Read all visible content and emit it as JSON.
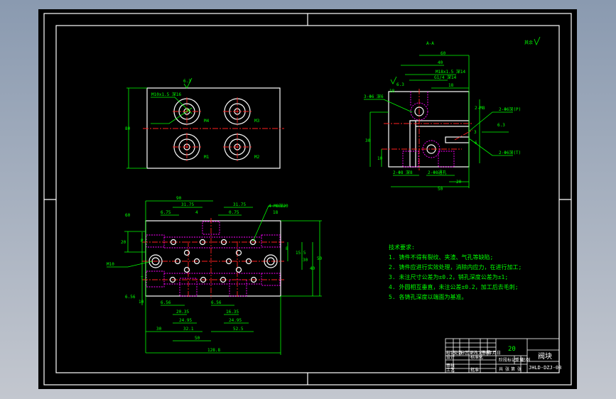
{
  "drawing": {
    "section_label": "A-A",
    "roughness_note": "其余",
    "roughness_value": "6.3",
    "top_view": {
      "dims": [
        "80",
        "6.3",
        "M10x1.5 深16",
        "M4",
        "M3",
        "M1",
        "M2"
      ]
    },
    "section_view": {
      "dims": [
        "60",
        "40",
        "M18x1.5 深14",
        "G1/4 深14",
        "18",
        "30",
        "6.3",
        "3-Φ6 深6",
        "2-Φ8 深8",
        "2-Φ8通孔",
        "2-M8",
        "10",
        "50",
        "20",
        "18",
        "6.3",
        "2-Φ6深(P)",
        "2-Φ6深(T)",
        "3",
        "6"
      ]
    },
    "front_view": {
      "dims": [
        "90",
        "31.75",
        "31.75",
        "6.75",
        "4",
        "0.75",
        "18",
        "4-M8深20",
        "20",
        "P",
        "T",
        "8",
        "15.5",
        "30",
        "40",
        "50",
        "60",
        "6.56",
        "6.56",
        "20.35",
        "16.35",
        "24.95",
        "24.95",
        "30",
        "32.1",
        "52.5",
        "50",
        "128.8",
        "M10",
        "10"
      ]
    },
    "tech_requirements": {
      "title": "技术要求:",
      "items": [
        "1. 铸件不得有裂纹、夹渣、气孔等缺陷;",
        "2. 铸件应进行实效处理，消除内应力，在进行加工;",
        "3. 未注尺寸公差为±0.2，销孔深度公差为±1;",
        "4. 外圆相互垂直，未注公差±0.2，加工后去毛刺;",
        "5. 各铸孔深度以端面为基准。"
      ]
    },
    "title_block": {
      "material": "20",
      "part_name": "阀块",
      "drawing_number": "JHLD-DZJ-08",
      "row_labels": [
        "标记",
        "处数",
        "分区",
        "更改文件号",
        "签名",
        "年月日"
      ],
      "cells": [
        "设计",
        "标准化",
        "审核",
        "工艺",
        "批准"
      ],
      "stage_labels": [
        "阶段标记",
        "重量",
        "比例"
      ],
      "sheet": [
        "共",
        "张",
        "第",
        "张"
      ]
    }
  },
  "colors": {
    "background": "#000000",
    "frame": "#ffffff",
    "dimension": "#00ff00",
    "centerline": "#ff2020",
    "hidden": "#ff00ff",
    "hatch": "#00c8d8"
  }
}
